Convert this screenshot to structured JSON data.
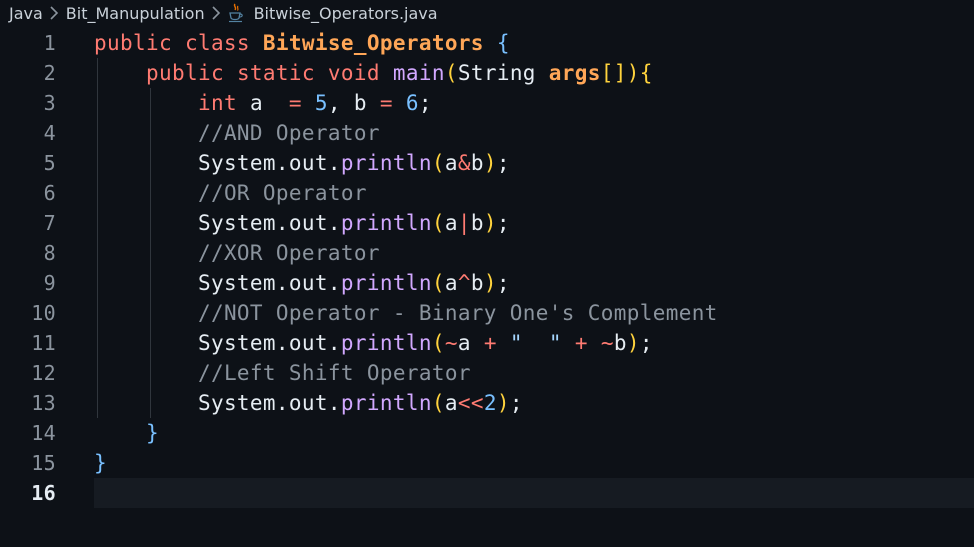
{
  "breadcrumb": {
    "items": [
      "Java",
      "Bit_Manupulation",
      "Bitwise_Operators.java"
    ],
    "file_icon": "java-coffee-icon",
    "separator_icon": "chevron-right-icon"
  },
  "editor": {
    "active_line": "16",
    "lines": [
      {
        "number": "1",
        "tokens": [
          {
            "t": "public ",
            "c": "kw"
          },
          {
            "t": "class ",
            "c": "kw"
          },
          {
            "t": "Bitwise_Operators",
            "c": "cls"
          },
          {
            "t": " ",
            "c": "plain"
          },
          {
            "t": "{",
            "c": "brace"
          }
        ]
      },
      {
        "number": "2",
        "tokens": [
          {
            "t": "    ",
            "c": "plain"
          },
          {
            "t": "public ",
            "c": "kw"
          },
          {
            "t": "static ",
            "c": "kw"
          },
          {
            "t": "void ",
            "c": "kw"
          },
          {
            "t": "main",
            "c": "fn"
          },
          {
            "t": "(",
            "c": "paren"
          },
          {
            "t": "String ",
            "c": "type"
          },
          {
            "t": "args",
            "c": "param"
          },
          {
            "t": "[]",
            "c": "paren"
          },
          {
            "t": ")",
            "c": "paren"
          },
          {
            "t": "{",
            "c": "paren"
          }
        ]
      },
      {
        "number": "3",
        "tokens": [
          {
            "t": "        ",
            "c": "plain"
          },
          {
            "t": "int ",
            "c": "kw"
          },
          {
            "t": "a  ",
            "c": "plain"
          },
          {
            "t": "=",
            "c": "op"
          },
          {
            "t": " ",
            "c": "plain"
          },
          {
            "t": "5",
            "c": "num"
          },
          {
            "t": ", b ",
            "c": "plain"
          },
          {
            "t": "=",
            "c": "op"
          },
          {
            "t": " ",
            "c": "plain"
          },
          {
            "t": "6",
            "c": "num"
          },
          {
            "t": ";",
            "c": "plain"
          }
        ]
      },
      {
        "number": "4",
        "tokens": [
          {
            "t": "        ",
            "c": "plain"
          },
          {
            "t": "//AND Operator",
            "c": "cm"
          }
        ]
      },
      {
        "number": "5",
        "tokens": [
          {
            "t": "        ",
            "c": "plain"
          },
          {
            "t": "System",
            "c": "plain"
          },
          {
            "t": ".",
            "c": "plain"
          },
          {
            "t": "out",
            "c": "field"
          },
          {
            "t": ".",
            "c": "plain"
          },
          {
            "t": "println",
            "c": "fn"
          },
          {
            "t": "(",
            "c": "paren"
          },
          {
            "t": "a",
            "c": "plain"
          },
          {
            "t": "&",
            "c": "op"
          },
          {
            "t": "b",
            "c": "plain"
          },
          {
            "t": ")",
            "c": "paren"
          },
          {
            "t": ";",
            "c": "plain"
          }
        ]
      },
      {
        "number": "6",
        "tokens": [
          {
            "t": "        ",
            "c": "plain"
          },
          {
            "t": "//OR Operator",
            "c": "cm"
          }
        ]
      },
      {
        "number": "7",
        "tokens": [
          {
            "t": "        ",
            "c": "plain"
          },
          {
            "t": "System",
            "c": "plain"
          },
          {
            "t": ".",
            "c": "plain"
          },
          {
            "t": "out",
            "c": "field"
          },
          {
            "t": ".",
            "c": "plain"
          },
          {
            "t": "println",
            "c": "fn"
          },
          {
            "t": "(",
            "c": "paren"
          },
          {
            "t": "a",
            "c": "plain"
          },
          {
            "t": "|",
            "c": "op"
          },
          {
            "t": "b",
            "c": "plain"
          },
          {
            "t": ")",
            "c": "paren"
          },
          {
            "t": ";",
            "c": "plain"
          }
        ]
      },
      {
        "number": "8",
        "tokens": [
          {
            "t": "        ",
            "c": "plain"
          },
          {
            "t": "//XOR Operator",
            "c": "cm"
          }
        ]
      },
      {
        "number": "9",
        "tokens": [
          {
            "t": "        ",
            "c": "plain"
          },
          {
            "t": "System",
            "c": "plain"
          },
          {
            "t": ".",
            "c": "plain"
          },
          {
            "t": "out",
            "c": "field"
          },
          {
            "t": ".",
            "c": "plain"
          },
          {
            "t": "println",
            "c": "fn"
          },
          {
            "t": "(",
            "c": "paren"
          },
          {
            "t": "a",
            "c": "plain"
          },
          {
            "t": "^",
            "c": "op"
          },
          {
            "t": "b",
            "c": "plain"
          },
          {
            "t": ")",
            "c": "paren"
          },
          {
            "t": ";",
            "c": "plain"
          }
        ]
      },
      {
        "number": "10",
        "tokens": [
          {
            "t": "        ",
            "c": "plain"
          },
          {
            "t": "//NOT Operator - Binary One's Complement",
            "c": "cm"
          }
        ]
      },
      {
        "number": "11",
        "tokens": [
          {
            "t": "        ",
            "c": "plain"
          },
          {
            "t": "System",
            "c": "plain"
          },
          {
            "t": ".",
            "c": "plain"
          },
          {
            "t": "out",
            "c": "field"
          },
          {
            "t": ".",
            "c": "plain"
          },
          {
            "t": "println",
            "c": "fn"
          },
          {
            "t": "(",
            "c": "paren"
          },
          {
            "t": "~",
            "c": "op"
          },
          {
            "t": "a ",
            "c": "plain"
          },
          {
            "t": "+",
            "c": "op"
          },
          {
            "t": " ",
            "c": "plain"
          },
          {
            "t": "\"  \"",
            "c": "str"
          },
          {
            "t": " ",
            "c": "plain"
          },
          {
            "t": "+",
            "c": "op"
          },
          {
            "t": " ",
            "c": "plain"
          },
          {
            "t": "~",
            "c": "op"
          },
          {
            "t": "b",
            "c": "plain"
          },
          {
            "t": ")",
            "c": "paren"
          },
          {
            "t": ";",
            "c": "plain"
          }
        ]
      },
      {
        "number": "12",
        "tokens": [
          {
            "t": "        ",
            "c": "plain"
          },
          {
            "t": "//Left Shift Operator",
            "c": "cm"
          }
        ]
      },
      {
        "number": "13",
        "tokens": [
          {
            "t": "        ",
            "c": "plain"
          },
          {
            "t": "System",
            "c": "plain"
          },
          {
            "t": ".",
            "c": "plain"
          },
          {
            "t": "out",
            "c": "field"
          },
          {
            "t": ".",
            "c": "plain"
          },
          {
            "t": "println",
            "c": "fn"
          },
          {
            "t": "(",
            "c": "paren"
          },
          {
            "t": "a",
            "c": "plain"
          },
          {
            "t": "<<",
            "c": "op"
          },
          {
            "t": "2",
            "c": "num"
          },
          {
            "t": ")",
            "c": "paren"
          },
          {
            "t": ";",
            "c": "plain"
          }
        ]
      },
      {
        "number": "14",
        "tokens": [
          {
            "t": "    ",
            "c": "plain"
          },
          {
            "t": "}",
            "c": "brace"
          }
        ]
      },
      {
        "number": "15",
        "tokens": [
          {
            "t": "}",
            "c": "brace"
          }
        ]
      },
      {
        "number": "16",
        "tokens": []
      }
    ]
  }
}
